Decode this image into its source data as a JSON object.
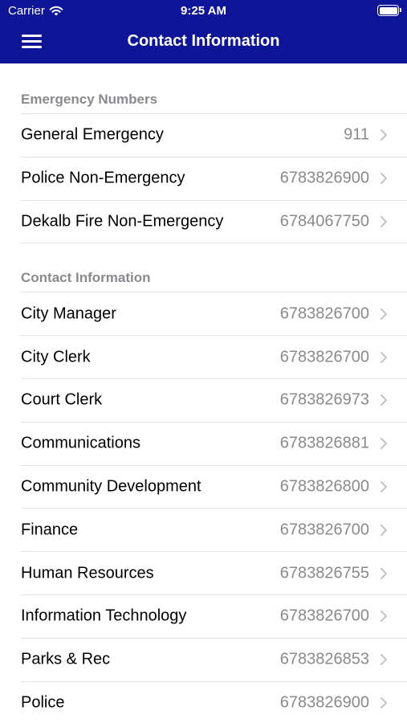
{
  "status_bar": {
    "carrier": "Carrier",
    "time": "9:25 AM"
  },
  "nav": {
    "title": "Contact Information",
    "menu_icon": "hamburger-menu-icon"
  },
  "colors": {
    "nav_background": "#0e1596",
    "secondary_text": "#8a8a8e"
  },
  "sections": [
    {
      "header": "Emergency Numbers",
      "rows": [
        {
          "label": "General Emergency",
          "value": "911"
        },
        {
          "label": "Police Non-Emergency",
          "value": "6783826900"
        },
        {
          "label": "Dekalb Fire Non-Emergency",
          "value": "6784067750"
        }
      ]
    },
    {
      "header": "Contact Information",
      "rows": [
        {
          "label": "City Manager",
          "value": "6783826700"
        },
        {
          "label": "City Clerk",
          "value": "6783826700"
        },
        {
          "label": "Court Clerk",
          "value": "6783826973"
        },
        {
          "label": "Communications",
          "value": "6783826881"
        },
        {
          "label": "Community Development",
          "value": "6783826800"
        },
        {
          "label": "Finance",
          "value": "6783826700"
        },
        {
          "label": "Human Resources",
          "value": "6783826755"
        },
        {
          "label": "Information Technology",
          "value": "6783826700"
        },
        {
          "label": "Parks & Rec",
          "value": "6783826853"
        },
        {
          "label": "Police",
          "value": "6783826900"
        }
      ]
    }
  ]
}
